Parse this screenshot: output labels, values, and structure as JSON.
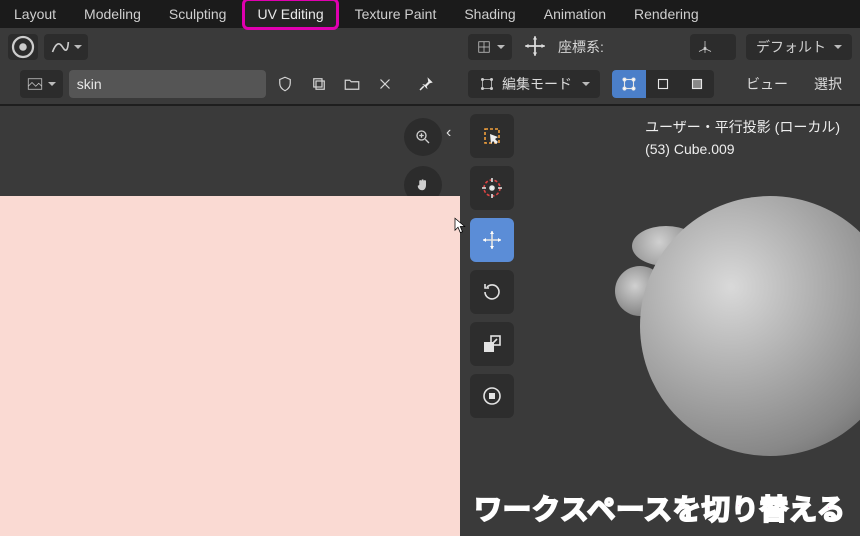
{
  "tabs": [
    "Layout",
    "Modeling",
    "Sculpting",
    "UV Editing",
    "Texture Paint",
    "Shading",
    "Animation",
    "Rendering"
  ],
  "active_tab_index": 3,
  "left": {
    "image_name": "skin"
  },
  "right": {
    "orientation_label": "座標系:",
    "transform_orientation": "デフォルト",
    "mode": "編集モード",
    "menu_view": "ビュー",
    "menu_select": "選択",
    "info_line1": "ユーザー・平行投影 (ローカル)",
    "info_line2": "(53) Cube.009"
  },
  "annotation": "ワークスペースを切り替える"
}
